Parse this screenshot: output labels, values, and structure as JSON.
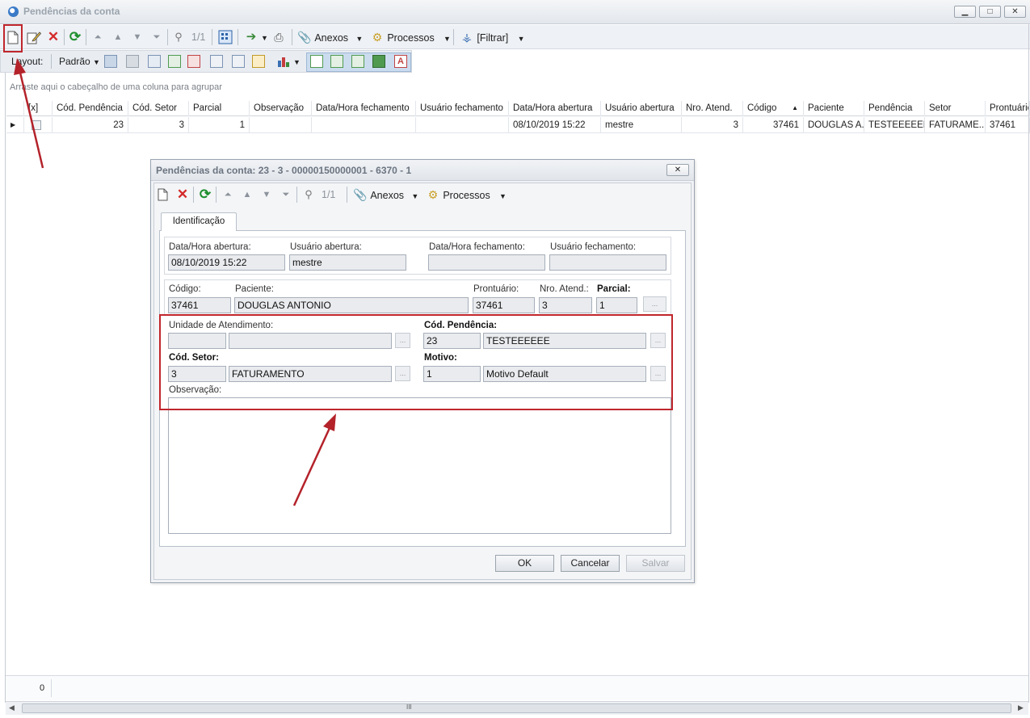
{
  "window": {
    "title": "Pendências da conta",
    "min_label": "▁",
    "max_label": "□",
    "close_label": "✕"
  },
  "toolbar": {
    "record_count": "1/1",
    "anexos": "Anexos",
    "processos": "Processos",
    "filtrar": "[Filtrar]"
  },
  "layout_bar": {
    "layout_label": "Layout:",
    "layout_value": "Padrão"
  },
  "group_hint": "Arraste aqui o cabeçalho de uma coluna para agrupar",
  "grid": {
    "columns": [
      "[x]",
      "Cód. Pendência",
      "Cód. Setor",
      "Parcial",
      "Observação",
      "Data/Hora fechamento",
      "Usuário fechamento",
      "Data/Hora abertura",
      "Usuário abertura",
      "Nro. Atend.",
      "Código",
      "Paciente",
      "Pendência",
      "Setor",
      "Prontuário"
    ],
    "rows": [
      {
        "cod_pendencia": "23",
        "cod_setor": "3",
        "parcial": "1",
        "observacao": "",
        "data_fechamento": "",
        "usuario_fechamento": "",
        "data_abertura": "08/10/2019 15:22",
        "usuario_abertura": "mestre",
        "nro_atend": "3",
        "codigo": "37461",
        "paciente": "DOUGLAS A...",
        "pendencia": "TESTEEEEEE",
        "setor": "FATURAME...",
        "prontuario": "37461"
      }
    ]
  },
  "footer": {
    "count": "0",
    "scroll_grip": "III"
  },
  "dialog": {
    "title": "Pendências da conta: 23 - 3 - 00000150000001 - 6370 - 1",
    "close_label": "✕",
    "toolbar": {
      "record_count": "1/1",
      "anexos": "Anexos",
      "processos": "Processos"
    },
    "tab": "Identificação",
    "labels": {
      "data_abertura": "Data/Hora abertura:",
      "usuario_abertura": "Usuário abertura:",
      "data_fechamento": "Data/Hora fechamento:",
      "usuario_fechamento": "Usuário fechamento:",
      "codigo": "Código:",
      "paciente": "Paciente:",
      "prontuario": "Prontuário:",
      "nro_atend": "Nro. Atend.:",
      "parcial": "Parcial:",
      "unidade": "Unidade de Atendimento:",
      "cod_pendencia": "Cód. Pendência:",
      "cod_setor": "Cód. Setor:",
      "motivo": "Motivo:",
      "observacao": "Observação:"
    },
    "values": {
      "data_abertura": "08/10/2019 15:22",
      "usuario_abertura": "mestre",
      "data_fechamento": "",
      "usuario_fechamento": "",
      "codigo": "37461",
      "paciente": "DOUGLAS ANTONIO",
      "prontuario": "37461",
      "nro_atend": "3",
      "parcial": "1",
      "unidade_codigo": "",
      "unidade_nome": "",
      "cod_pendencia": "23",
      "pendencia_nome": "TESTEEEEEE",
      "cod_setor": "3",
      "setor_nome": "FATURAMENTO",
      "motivo_codigo": "1",
      "motivo_nome": "Motivo Default",
      "observacao": ""
    },
    "ellipsis": "...",
    "buttons": {
      "ok": "OK",
      "cancelar": "Cancelar",
      "salvar": "Salvar"
    }
  },
  "colors": {
    "annotation_red": "#c0262c",
    "title_gray": "#9aa3ad"
  }
}
